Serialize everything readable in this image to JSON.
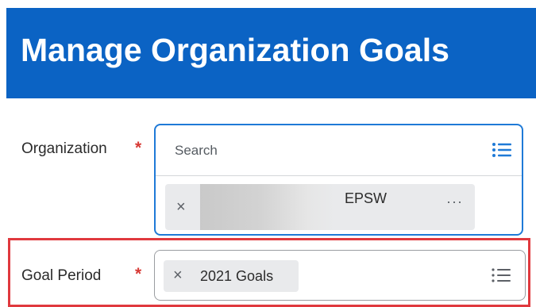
{
  "header": {
    "title": "Manage Organization Goals"
  },
  "organization": {
    "label": "Organization",
    "required_mark": "*",
    "search_placeholder": "Search",
    "list_icon": "prompt-list-icon",
    "selected_item": {
      "remove_glyph": "×",
      "label": "EPSW",
      "more_glyph": "···"
    }
  },
  "goal_period": {
    "label": "Goal Period",
    "required_mark": "*",
    "list_icon": "prompt-list-icon",
    "selected_item": {
      "remove_glyph": "×",
      "label": "2021 Goals"
    }
  },
  "colors": {
    "header_bg": "#0b63c4",
    "required": "#d73a35",
    "focus_border": "#1f7ad7",
    "highlight_frame": "#e0393e"
  }
}
